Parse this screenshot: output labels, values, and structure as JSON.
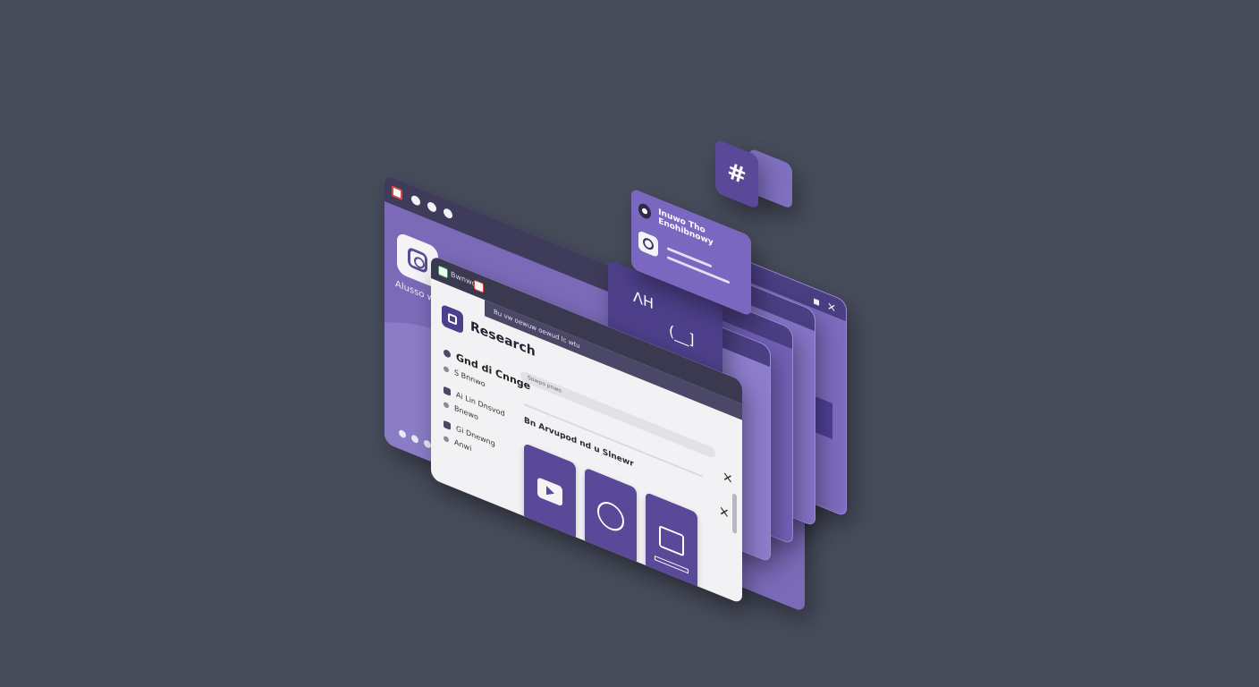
{
  "back_window": {
    "app_label": "Alusso ww",
    "pager_dots": 3
  },
  "chat": {
    "hash_symbol": "#",
    "message_title": "Inuwo Tho Enohibnowy",
    "tower_glyph": "ᐱᕼ",
    "tower_glyph2": "(__]"
  },
  "stack": {
    "window_controls": [
      "▪",
      "✕"
    ]
  },
  "front_window": {
    "tab_text": "Bwnwo",
    "subheader": "Bu vw oewuw oewud lc wtu",
    "title": "Research",
    "sidebar": [
      {
        "label": "Gnd di Cnnge",
        "style": "big"
      },
      {
        "label": "S Bnnwo",
        "style": "small"
      },
      {
        "label": "Ai Lin Dnsvod",
        "style": "box"
      },
      {
        "label": "Bnewo",
        "style": "small"
      },
      {
        "label": "Gi Dnewng",
        "style": "box"
      },
      {
        "label": "Anwi",
        "style": "small"
      }
    ],
    "search_placeholder": "Sowpo pnwo",
    "content_heading": "Bn Arvupod nd u Slnewr",
    "close_label": "✕",
    "close_label2": "✕",
    "tiles": [
      {
        "icon": "video-play-icon",
        "caption": "◦"
      },
      {
        "icon": "user-circle-icon",
        "caption": "◦"
      },
      {
        "icon": "chat-monitors-icon",
        "caption": "•••"
      }
    ]
  },
  "colors": {
    "background": "#474c5b",
    "accent": "#5a4898",
    "panel_purple": "#7b6ab8",
    "window_light": "#f2f2f4"
  }
}
